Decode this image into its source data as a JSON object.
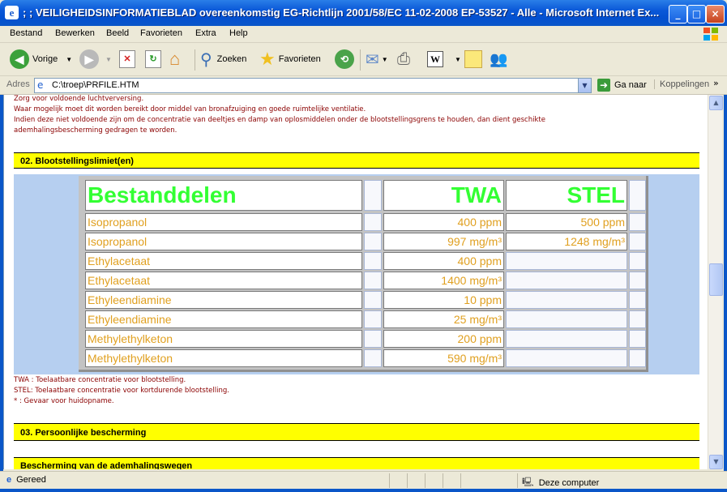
{
  "window": {
    "title": "; ; VEILIGHEIDSINFORMATIEBLAD overeenkomstig EG-Richtlijn 2001/58/EC 11-02-2008 EP-53527 - Alle - Microsoft Internet Ex...",
    "controls": {
      "minimize": "_",
      "maximize": "□",
      "close": "×"
    }
  },
  "menu": [
    "Bestand",
    "Bewerken",
    "Beeld",
    "Favorieten",
    "Extra",
    "Help"
  ],
  "toolbar": {
    "back_label": "Vorige",
    "search_label": "Zoeken",
    "favorites_label": "Favorieten"
  },
  "address": {
    "label": "Adres",
    "value": "C:\\troep\\PRFILE.HTM",
    "go_label": "Ga naar",
    "links_label": "Koppelingen"
  },
  "content": {
    "intro_lines": [
      "Zorg voor voldoende luchtverversing.",
      "Waar mogelijk moet dit worden bereikt door middel van bronafzuiging en goede ruimtelijke ventilatie.",
      "Indien deze niet voldoende zijn om de concentratie van deeltjes en damp van oplosmiddelen onder de blootstellingsgrens te houden, dan dient geschikte",
      "ademhalingsbescherming gedragen te worden."
    ],
    "section2_title": "02. Blootstellingslimiet(en)",
    "table": {
      "headers": [
        "Bestanddelen",
        "",
        "TWA",
        "STEL",
        ""
      ],
      "rows": [
        [
          "Isopropanol",
          "",
          "400 ppm",
          "500 ppm",
          ""
        ],
        [
          "Isopropanol",
          "",
          "997 mg/m³",
          "1248 mg/m³",
          ""
        ],
        [
          "Ethylacetaat",
          "",
          "400 ppm",
          "",
          ""
        ],
        [
          "Ethylacetaat",
          "",
          "1400 mg/m³",
          "",
          ""
        ],
        [
          "Ethyleendiamine",
          "",
          "10 ppm",
          "",
          ""
        ],
        [
          "Ethyleendiamine",
          "",
          "25 mg/m³",
          "",
          ""
        ],
        [
          "Methylethylketon",
          "",
          "200 ppm",
          "",
          ""
        ],
        [
          "Methylethylketon",
          "",
          "590 mg/m³",
          "",
          ""
        ]
      ]
    },
    "footnotes": [
      "TWA : Toelaatbare concentratie voor blootstelling.",
      "STEL: Toelaatbare concentratie voor kortdurende blootstelling.",
      "* : Gevaar voor huidopname."
    ],
    "section3_title": "03. Persoonlijke bescherming",
    "section4_title": "Bescherming van de ademhalingswegen"
  },
  "status": {
    "left": "Gereed",
    "right": "Deze computer"
  },
  "colors": {
    "section_bg": "#ffff00",
    "note_text": "#8b0000",
    "header_text": "#33ff33",
    "data_text": "#e0a020",
    "band_bg": "#b6cff0"
  }
}
